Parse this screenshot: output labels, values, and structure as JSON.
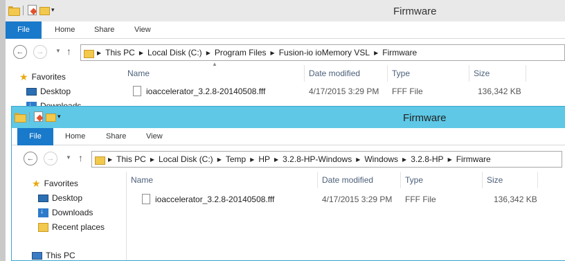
{
  "back_window": {
    "title": "Firmware",
    "ribbon_tabs": [
      "File",
      "Home",
      "Share",
      "View"
    ],
    "address": [
      "This PC",
      "Local Disk (C:)",
      "Program Files",
      "Fusion-io ioMemory VSL",
      "Firmware"
    ],
    "nav_pane": [
      "Favorites",
      "Desktop",
      "Downloads"
    ],
    "columns": [
      "Name",
      "Date modified",
      "Type",
      "Size"
    ],
    "files": [
      {
        "name": "ioaccelerator_3.2.8-20140508.fff",
        "date": "4/17/2015 3:29 PM",
        "type": "FFF File",
        "size": "136,342 KB"
      }
    ]
  },
  "front_window": {
    "title": "Firmware",
    "ribbon_tabs": [
      "File",
      "Home",
      "Share",
      "View"
    ],
    "address": [
      "This PC",
      "Local Disk (C:)",
      "Temp",
      "HP",
      "3.2.8-HP-Windows",
      "Windows",
      "3.2.8-HP",
      "Firmware"
    ],
    "nav_pane": [
      "Favorites",
      "Desktop",
      "Downloads",
      "Recent places",
      "This PC"
    ],
    "columns": [
      "Name",
      "Date modified",
      "Type",
      "Size"
    ],
    "files": [
      {
        "name": "ioaccelerator_3.2.8-20140508.fff",
        "date": "4/17/2015 3:29 PM",
        "type": "FFF File",
        "size": "136,342 KB"
      }
    ]
  },
  "colors": {
    "accent": "#1979ca",
    "active_titlebar": "#5ec8e6",
    "inactive_titlebar": "#e9e9e9"
  },
  "icons": [
    "folder-icon",
    "properties-icon",
    "back-icon",
    "forward-icon",
    "up-icon",
    "star-icon",
    "desktop-icon",
    "downloads-icon",
    "recent-places-icon",
    "this-pc-icon",
    "file-icon"
  ]
}
